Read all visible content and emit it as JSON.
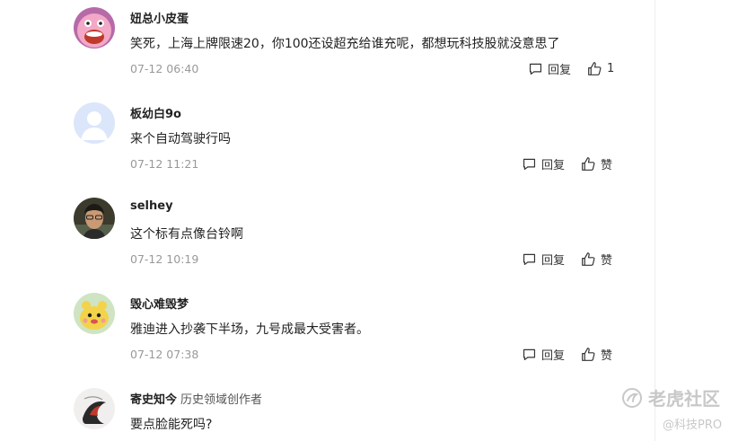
{
  "comments": [
    {
      "username": "妞总小皮蛋",
      "user_title": "",
      "text": "笑死，上海上牌限速20，你100还设超充给谁充呢，都想玩科技股就没意思了",
      "time": "07-12 06:40",
      "reply_label": "回复",
      "like_label": "1",
      "avatar_icon": "cartoon-face-avatar"
    },
    {
      "username": "板幼白9o",
      "user_title": "",
      "text": "来个自动驾驶行吗",
      "time": "07-12 11:21",
      "reply_label": "回复",
      "like_label": "赞",
      "avatar_icon": "default-user-avatar"
    },
    {
      "username": "selhey",
      "user_title": "",
      "text": "这个标有点像台铃啊",
      "time": "07-12 10:19",
      "reply_label": "回复",
      "like_label": "赞",
      "avatar_icon": "photo-avatar"
    },
    {
      "username": "毁心难毁梦",
      "user_title": "",
      "text": "雅迪进入抄袭下半场，九号成最大受害者。",
      "time": "07-12 07:38",
      "reply_label": "回复",
      "like_label": "赞",
      "avatar_icon": "cartoon-character-avatar"
    },
    {
      "username": "寄史知今",
      "user_title": "历史领域创作者",
      "text": "要点脸能死吗?",
      "time": "",
      "reply_label": "",
      "like_label": "",
      "avatar_icon": "sketch-avatar"
    }
  ],
  "watermark": {
    "brand": "老虎社区",
    "sub": "@科技PRO",
    "icon": "tiger-logo-icon"
  },
  "colors": {
    "text": "#222222",
    "meta": "#999999",
    "watermark": "#c8c8c8"
  }
}
